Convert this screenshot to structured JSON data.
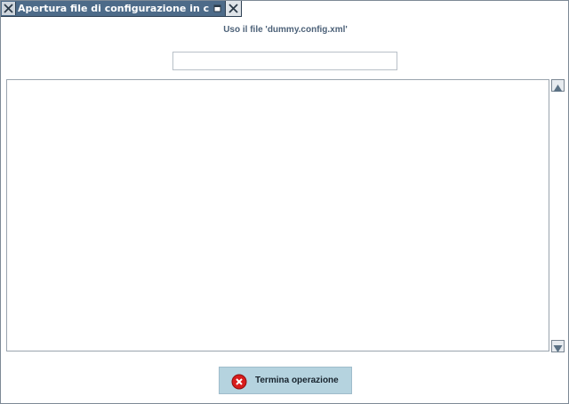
{
  "window": {
    "title": "Apertura file di configurazione in corso..."
  },
  "main": {
    "file_label": "Uso il file 'dummy.config.xml'",
    "progress": 0,
    "log_text": ""
  },
  "buttons": {
    "stop_label": "Termina operazione"
  },
  "icons": {
    "window_menu": "close-x-icon",
    "maximize": "maximize-icon",
    "close": "close-x-icon",
    "scroll_up": "arrow-up-icon",
    "scroll_down": "arrow-down-icon",
    "stop": "stop-error-icon"
  },
  "colors": {
    "titlebar": "#4d6b89",
    "button_bg": "#b5d3df",
    "stop_icon": "#d81c1c"
  }
}
